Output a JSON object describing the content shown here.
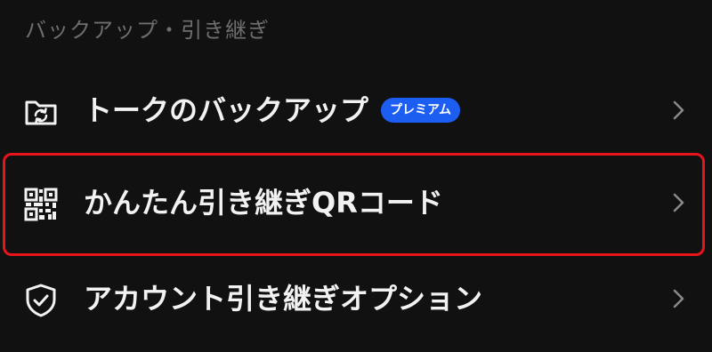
{
  "section": {
    "title": "バックアップ・引き継ぎ"
  },
  "rows": [
    {
      "label": "トークのバックアップ",
      "badge": "プレミアム",
      "icon": "folder-sync-icon"
    },
    {
      "label": "かんたん引き継ぎQRコード",
      "icon": "qr-code-icon"
    },
    {
      "label": "アカウント引き継ぎオプション",
      "icon": "shield-check-icon"
    }
  ],
  "colors": {
    "background": "#111111",
    "text": "#f2f2f2",
    "section_header": "#6e6e6e",
    "badge": "#1c5df2",
    "highlight": "#e8141c",
    "chevron": "#8a8a8a"
  }
}
